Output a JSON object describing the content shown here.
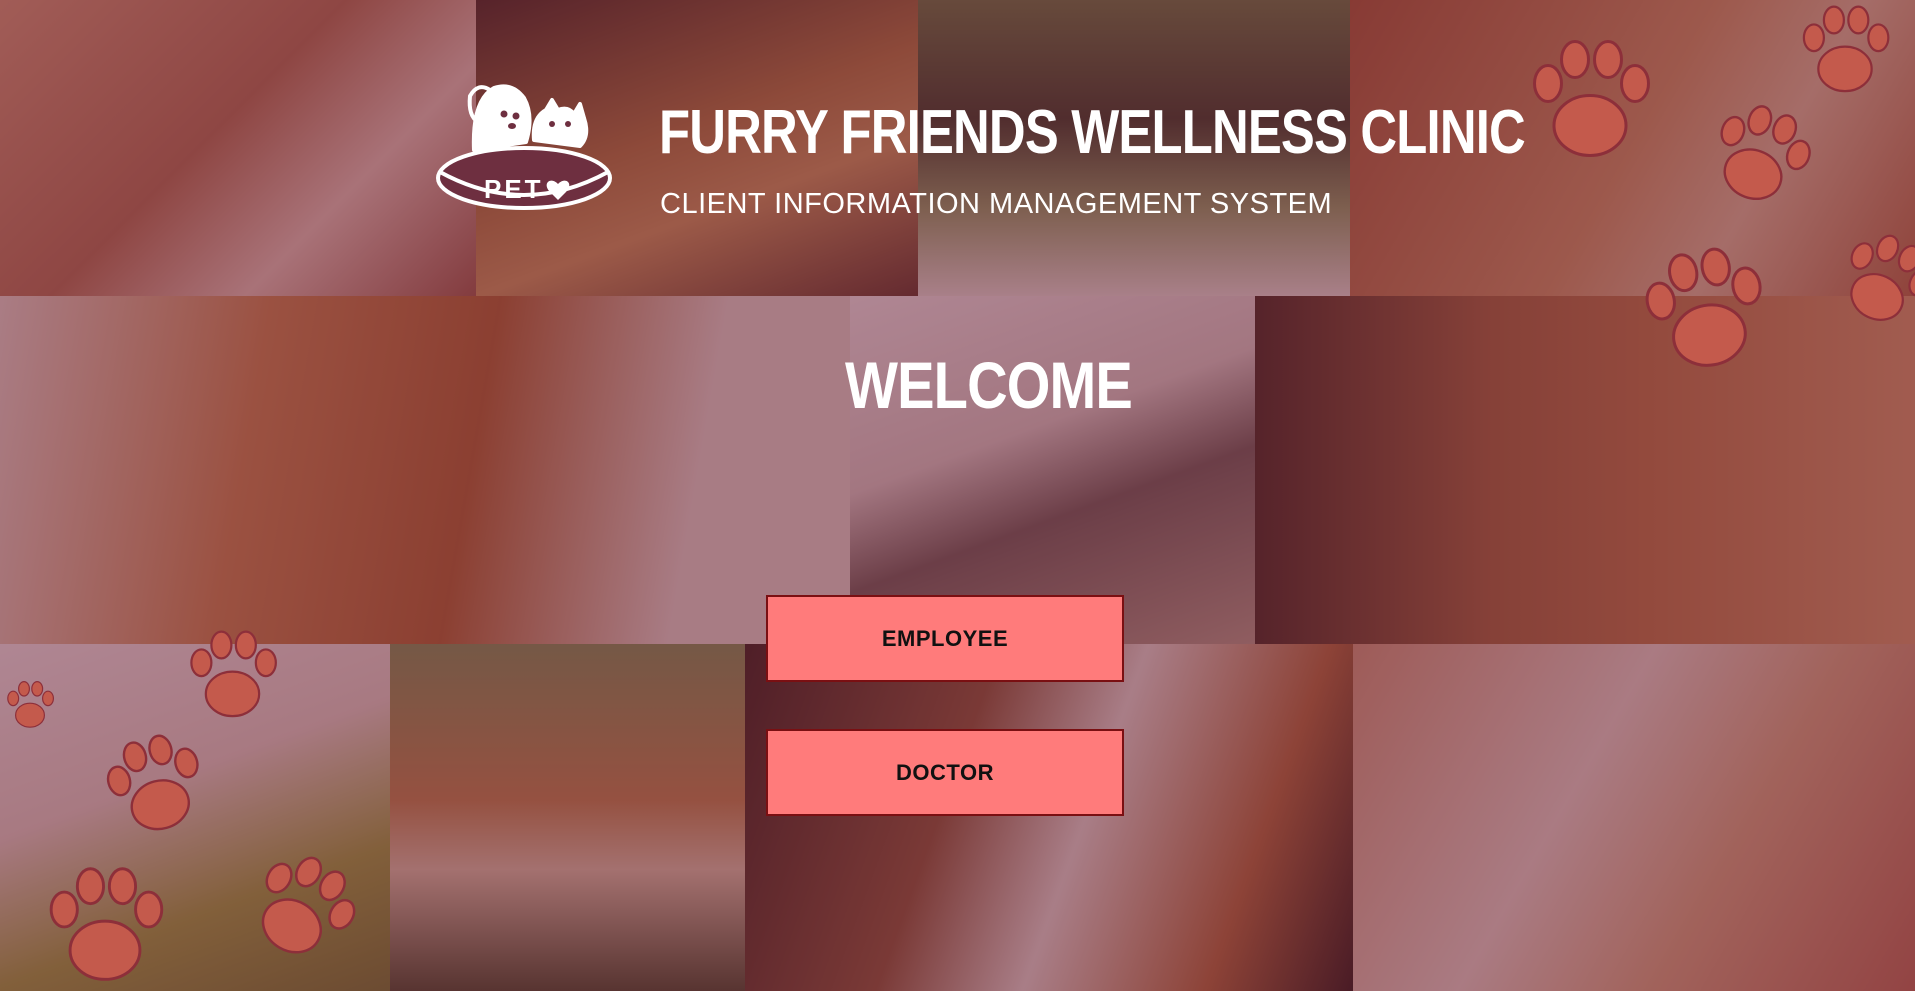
{
  "header": {
    "logo_text": "PET",
    "title": "FURRY FRIENDS WELLNESS CLINIC",
    "subtitle": "CLIENT INFORMATION MANAGEMENT SYSTEM"
  },
  "main": {
    "welcome": "WELCOME"
  },
  "buttons": {
    "employee": "EMPLOYEE",
    "doctor": "DOCTOR"
  },
  "background": {
    "photos": [
      "cat-photo",
      "golden-retriever-photo",
      "rabbit-photo",
      "hamster-photo",
      "dog-with-kitten-photo",
      "puppy-kitten-parrot-photo",
      "german-shepherd-cat-photo",
      "parrot-photo",
      "guinea-pigs-photo",
      "three-dogs-photo",
      "two-cats-photo"
    ]
  },
  "colors": {
    "overlay": "#6e2f40",
    "button_fill": "#ff7b7b",
    "button_border": "#7a0f12",
    "paw": "#c45a4c"
  }
}
